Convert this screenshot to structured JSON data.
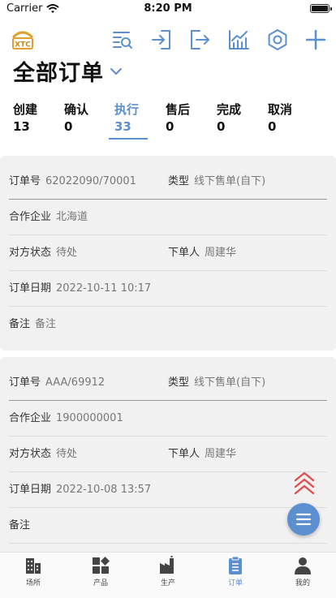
{
  "status_bar": {
    "carrier": "Carrier",
    "time": "8:20 PM"
  },
  "logo": {
    "text": "XTC"
  },
  "toolbar_icons": [
    "search-list-icon",
    "login-icon",
    "logout-icon",
    "chart-icon",
    "settings-icon",
    "add-icon"
  ],
  "header": {
    "title": "全部订单"
  },
  "tabs": [
    {
      "label": "创建",
      "count": "13"
    },
    {
      "label": "确认",
      "count": "0"
    },
    {
      "label": "执行",
      "count": "33"
    },
    {
      "label": "售后",
      "count": "0"
    },
    {
      "label": "完成",
      "count": "0"
    },
    {
      "label": "取消",
      "count": "0"
    }
  ],
  "active_tab": "执行",
  "orders": [
    {
      "order_no_label": "订单号",
      "order_no": "62022090/70001",
      "type_label": "类型",
      "type": "线下售单(自下)",
      "company_label": "合作企业",
      "company": "北海道",
      "status_label": "对方状态",
      "status": "待处",
      "orderer_label": "下单人",
      "orderer": "周建华",
      "date_label": "订单日期",
      "date": "2022-10-11 10:17",
      "note_label": "备注",
      "note": "备注"
    },
    {
      "order_no_label": "订单号",
      "order_no": "AAA/69912",
      "type_label": "类型",
      "type": "线下售单(自下)",
      "company_label": "合作企业",
      "company": "1900000001",
      "status_label": "对方状态",
      "status": "待处",
      "orderer_label": "下单人",
      "orderer": "周建华",
      "date_label": "订单日期",
      "date": "2022-10-08 13:57",
      "note_label": "备注",
      "note": ""
    }
  ],
  "tab_bar": [
    {
      "label": "场所",
      "icon": "building-icon"
    },
    {
      "label": "产品",
      "icon": "product-icon"
    },
    {
      "label": "生产",
      "icon": "factory-icon"
    },
    {
      "label": "订单",
      "icon": "clipboard-icon"
    },
    {
      "label": "我的",
      "icon": "user-icon"
    }
  ],
  "active_tab_bar": "订单",
  "colors": {
    "accent": "#5b8fcf",
    "up_arrow": "#e04a4a",
    "card_bg": "#f1f1f1"
  }
}
